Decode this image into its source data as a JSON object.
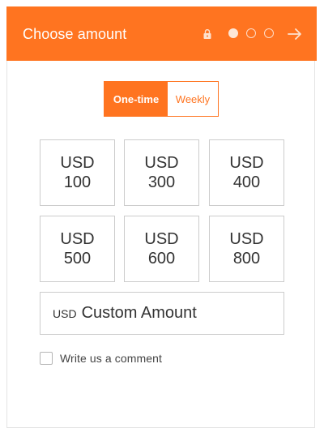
{
  "header": {
    "title": "Choose amount",
    "icons": {
      "lock": "lock-icon",
      "next": "arrow-right-icon"
    },
    "steps": {
      "total": 3,
      "current": 1
    }
  },
  "frequency": {
    "options": [
      "One-time",
      "Weekly"
    ],
    "selected": "One-time"
  },
  "amounts": [
    {
      "currency": "USD",
      "value": "100"
    },
    {
      "currency": "USD",
      "value": "300"
    },
    {
      "currency": "USD",
      "value": "400"
    },
    {
      "currency": "USD",
      "value": "500"
    },
    {
      "currency": "USD",
      "value": "600"
    },
    {
      "currency": "USD",
      "value": "800"
    }
  ],
  "custom": {
    "currency": "USD",
    "placeholder": "Custom Amount",
    "value": ""
  },
  "comment": {
    "label": "Write us a comment",
    "checked": false
  },
  "colors": {
    "accent": "#ff7420",
    "text": "#333333",
    "border": "#cccccc"
  }
}
